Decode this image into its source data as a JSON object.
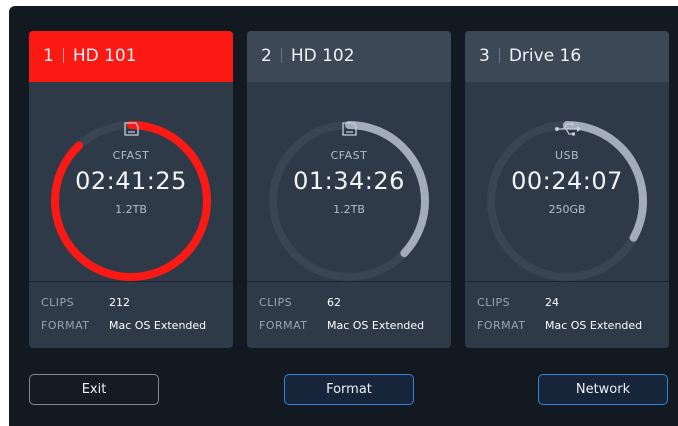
{
  "colors": {
    "active_header": "#fb1a13",
    "active_ring": "#fb1a13",
    "inactive_ring": "#a3adb9",
    "ring_track": "#394553",
    "card_background": "#2e3a48",
    "screen_background": "#131921",
    "button_accent": "#2e86d8"
  },
  "cards": [
    {
      "number": "1",
      "name": "HD 101",
      "active": true,
      "media_icon": "cfast-card-icon",
      "media_type": "CFAST",
      "timecode": "02:41:25",
      "capacity": "1.2TB",
      "clips_label": "CLIPS",
      "clips_value": "212",
      "format_label": "FORMAT",
      "format_value": "Mac OS Extended",
      "ring_fill": 0.88
    },
    {
      "number": "2",
      "name": "HD 102",
      "active": false,
      "media_icon": "cfast-card-icon",
      "media_type": "CFAST",
      "timecode": "01:34:26",
      "capacity": "1.2TB",
      "clips_label": "CLIPS",
      "clips_value": "62",
      "format_label": "FORMAT",
      "format_value": "Mac OS Extended",
      "ring_fill": 0.37
    },
    {
      "number": "3",
      "name": "Drive 16",
      "active": false,
      "media_icon": "usb-icon",
      "media_type": "USB",
      "timecode": "00:24:07",
      "capacity": "250GB",
      "clips_label": "CLIPS",
      "clips_value": "24",
      "format_label": "FORMAT",
      "format_value": "Mac OS Extended",
      "ring_fill": 0.33
    }
  ],
  "buttons": {
    "exit": "Exit",
    "format": "Format",
    "network": "Network"
  }
}
